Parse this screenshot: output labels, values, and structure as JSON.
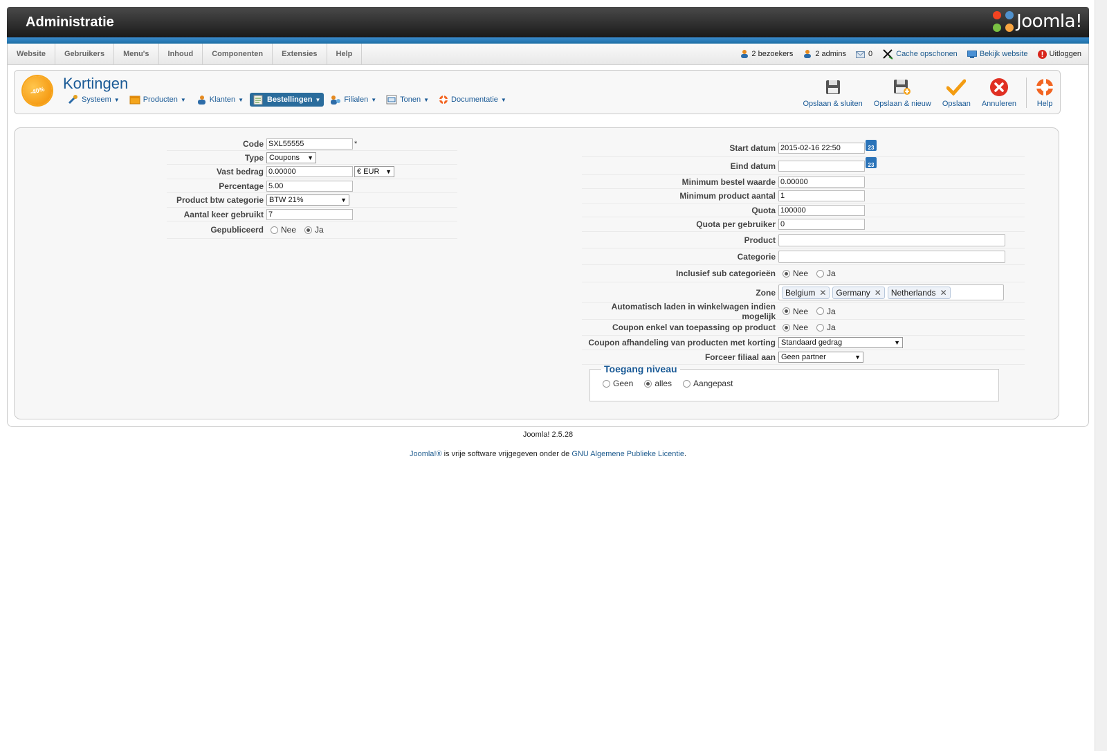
{
  "header": {
    "title": "Administratie",
    "logo_text": "Joomla!"
  },
  "menu": [
    "Website",
    "Gebruikers",
    "Menu's",
    "Inhoud",
    "Componenten",
    "Extensies",
    "Help"
  ],
  "status": {
    "visitors": "2 bezoekers",
    "admins": "2 admins",
    "messages": "0",
    "cache": "Cache opschonen",
    "view_site": "Bekijk website",
    "logout": "Uitloggen"
  },
  "page": {
    "title": "Kortingen",
    "badge": "-40%"
  },
  "submenu": [
    "Systeem",
    "Producten",
    "Klanten",
    "Bestellingen",
    "Filialen",
    "Tonen",
    "Documentatie"
  ],
  "submenu_active": "Bestellingen",
  "toolbar": {
    "save_close": "Opslaan & sluiten",
    "save_new": "Opslaan & nieuw",
    "save": "Opslaan",
    "cancel": "Annuleren",
    "help": "Help"
  },
  "left_form": {
    "code": {
      "label": "Code",
      "value": "SXL55555",
      "required": "*"
    },
    "type": {
      "label": "Type",
      "value": "Coupons"
    },
    "fixed": {
      "label": "Vast bedrag",
      "value": "0.00000",
      "currency": "€ EUR"
    },
    "percentage": {
      "label": "Percentage",
      "value": "5.00"
    },
    "vat": {
      "label": "Product btw categorie",
      "value": "BTW 21%"
    },
    "times_used": {
      "label": "Aantal keer gebruikt",
      "value": "7"
    },
    "published": {
      "label": "Gepubliceerd",
      "no": "Nee",
      "yes": "Ja",
      "selected": "Ja"
    }
  },
  "right_form": {
    "start": {
      "label": "Start datum",
      "value": "2015-02-16 22:50"
    },
    "end": {
      "label": "Eind datum",
      "value": ""
    },
    "calendar_icon_text": "23",
    "min_order": {
      "label": "Minimum bestel waarde",
      "value": "0.00000"
    },
    "min_product": {
      "label": "Minimum product aantal",
      "value": "1"
    },
    "quota": {
      "label": "Quota",
      "value": "100000"
    },
    "quota_user": {
      "label": "Quota per gebruiker",
      "value": "0"
    },
    "product": {
      "label": "Product",
      "value": ""
    },
    "category": {
      "label": "Categorie",
      "value": ""
    },
    "sub_cat": {
      "label": "Inclusief sub categorieën",
      "no": "Nee",
      "yes": "Ja",
      "selected": "Nee"
    },
    "zone": {
      "label": "Zone",
      "tags": [
        "Belgium",
        "Germany",
        "Netherlands"
      ]
    },
    "auto_load": {
      "label": "Automatisch laden in winkelwagen indien mogelijk",
      "no": "Nee",
      "yes": "Ja",
      "selected": "Nee"
    },
    "coupon_product": {
      "label": "Coupon enkel van toepassing op product",
      "no": "Nee",
      "yes": "Ja",
      "selected": "Nee"
    },
    "coupon_handling": {
      "label": "Coupon afhandeling van producten met korting",
      "value": "Standaard gedrag"
    },
    "force_branch": {
      "label": "Forceer filiaal aan",
      "value": "Geen partner"
    }
  },
  "access": {
    "legend": "Toegang niveau",
    "options": [
      "Geen",
      "alles",
      "Aangepast"
    ],
    "selected": "alles"
  },
  "footer": {
    "version": "Joomla! 2.5.28",
    "link1": "Joomla!®",
    "text": " is vrije software vrijgegeven onder de ",
    "link2": "GNU Algemene Publieke Licentie",
    "end": "."
  },
  "colors": {
    "brand_blue": "#1a5a96",
    "active_tab": "#2a6c9c",
    "badge_orange": "#f28c00"
  }
}
